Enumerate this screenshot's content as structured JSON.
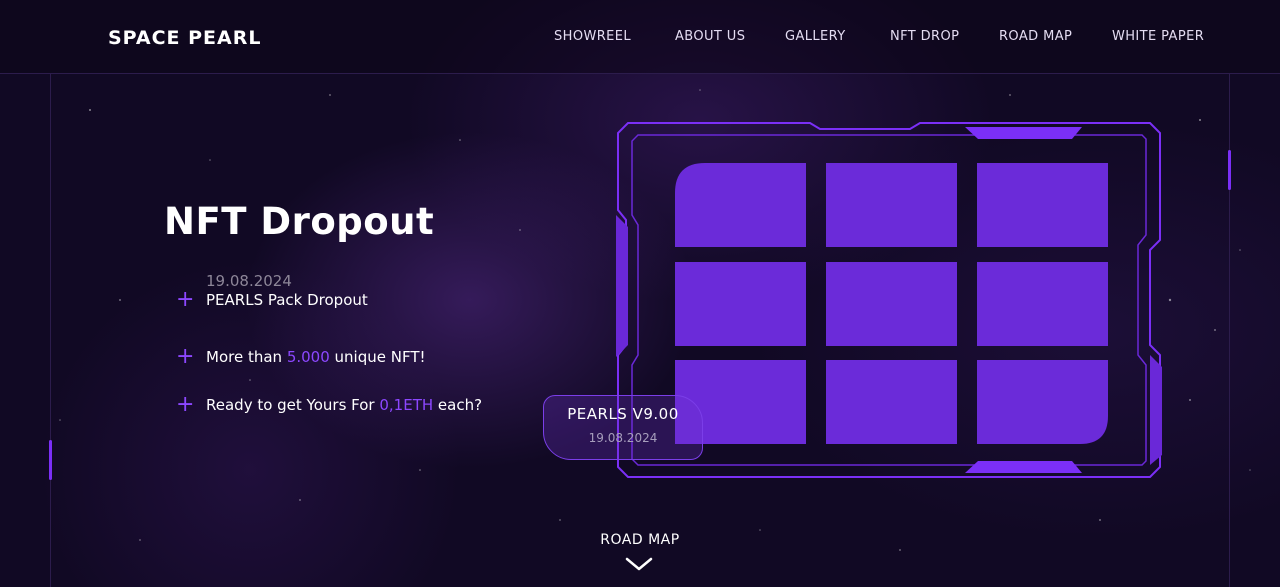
{
  "brand": {
    "logo_text": "SPACE PEARL"
  },
  "nav": {
    "items": [
      {
        "label": "SHOWREEL"
      },
      {
        "label": "ABOUT US"
      },
      {
        "label": "GALLERY"
      },
      {
        "label": "NFT DROP"
      },
      {
        "label": "ROAD MAP"
      },
      {
        "label": "WHITE PAPER"
      }
    ]
  },
  "hero": {
    "title": "NFT Dropout",
    "items": [
      {
        "date": "19.08.2024",
        "text": "PEARLS Pack Dropout"
      },
      {
        "prefix": "More than ",
        "highlight": "5.000",
        "suffix": " unique NFT!"
      },
      {
        "prefix": "Ready to get Yours For ",
        "highlight": "0,1ETH",
        "suffix": " each?"
      }
    ]
  },
  "card": {
    "title": "PEARLS V9.00",
    "date": "19.08.2024"
  },
  "footer": {
    "roadmap_label": "ROAD MAP",
    "scroll_icon": "chevron-down-icon"
  },
  "colors": {
    "accent": "#7b2ff7",
    "tile": "#6b2bd9",
    "background": "#110924"
  }
}
